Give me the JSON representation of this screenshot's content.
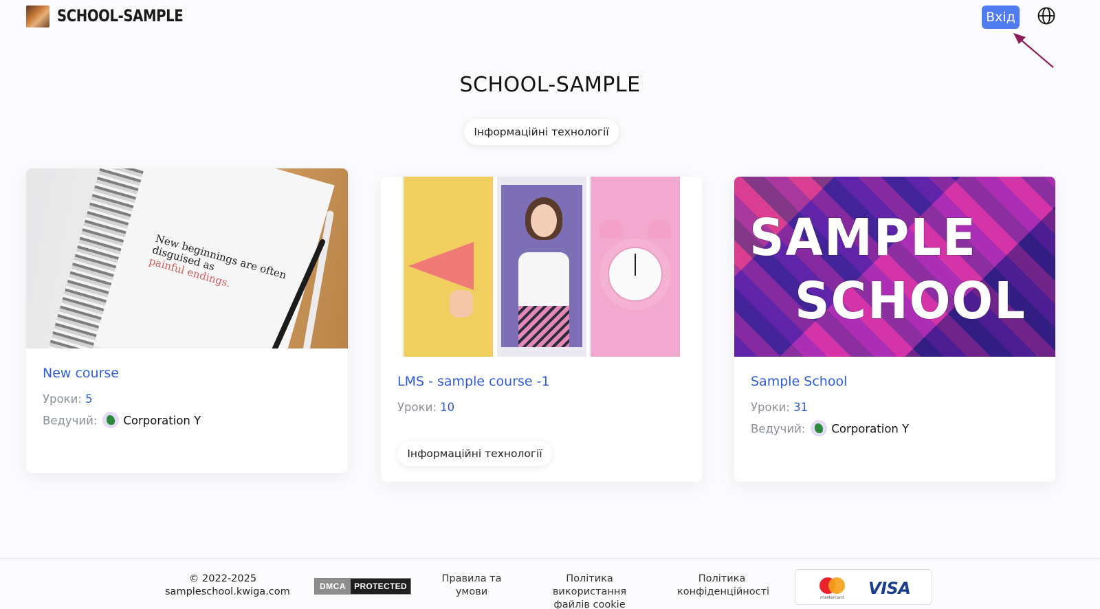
{
  "header": {
    "logo_text": "SCHOOL-SAMPLE",
    "login_label": "Вхід",
    "accent_color": "#4f7cf0"
  },
  "main": {
    "title": "SCHOOL-SAMPLE",
    "category": "Інформаційні технології"
  },
  "courses": [
    {
      "title": "New course",
      "lessons_label": "Уроки:",
      "lessons": "5",
      "host_label": "Ведучий:",
      "host": "Corporation Y",
      "image_text": [
        "New beginnings are often",
        "disguised as",
        "painful endings."
      ]
    },
    {
      "title": "LMS - sample course -1",
      "lessons_label": "Уроки:",
      "lessons": "10",
      "tag": "Інформаційні технології"
    },
    {
      "title": "Sample School",
      "lessons_label": "Уроки:",
      "lessons": "31",
      "host_label": "Ведучий:",
      "host": "Corporation Y",
      "image_text": [
        "SAMPLE",
        "SCHOOL"
      ]
    }
  ],
  "footer": {
    "copyright": "© 2022-2025",
    "domain": "sampleschool.kwiga.com",
    "dmca_left": "DMCA",
    "dmca_right": "PROTECTED",
    "terms": [
      "Правила та",
      "умови"
    ],
    "cookies": [
      "Політика використання",
      "файлів cookie"
    ],
    "privacy": [
      "Політика",
      "конфіденційності"
    ],
    "payment_mastercard": "mastercard",
    "payment_visa": "VISA"
  },
  "icons": {
    "globe": "globe-icon",
    "avatar": "dinosaur-avatar"
  }
}
